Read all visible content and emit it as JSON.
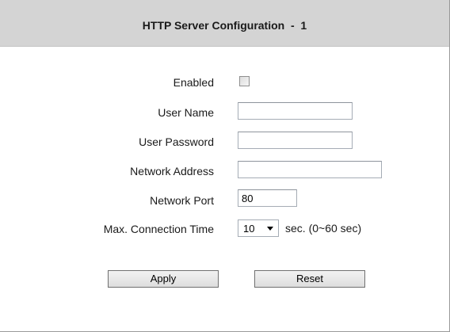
{
  "header": {
    "title": "HTTP Server Configuration  -  1"
  },
  "form": {
    "enabled": {
      "label": "Enabled",
      "checked": false
    },
    "user_name": {
      "label": "User Name",
      "value": ""
    },
    "user_password": {
      "label": "User Password",
      "value": ""
    },
    "network_address": {
      "label": "Network Address",
      "value": ""
    },
    "network_port": {
      "label": "Network Port",
      "value": "80"
    },
    "max_connection_time": {
      "label": "Max. Connection Time",
      "selected": "10",
      "suffix": "sec. (0~60 sec)"
    }
  },
  "buttons": {
    "apply_label": "Apply",
    "reset_label": "Reset"
  }
}
